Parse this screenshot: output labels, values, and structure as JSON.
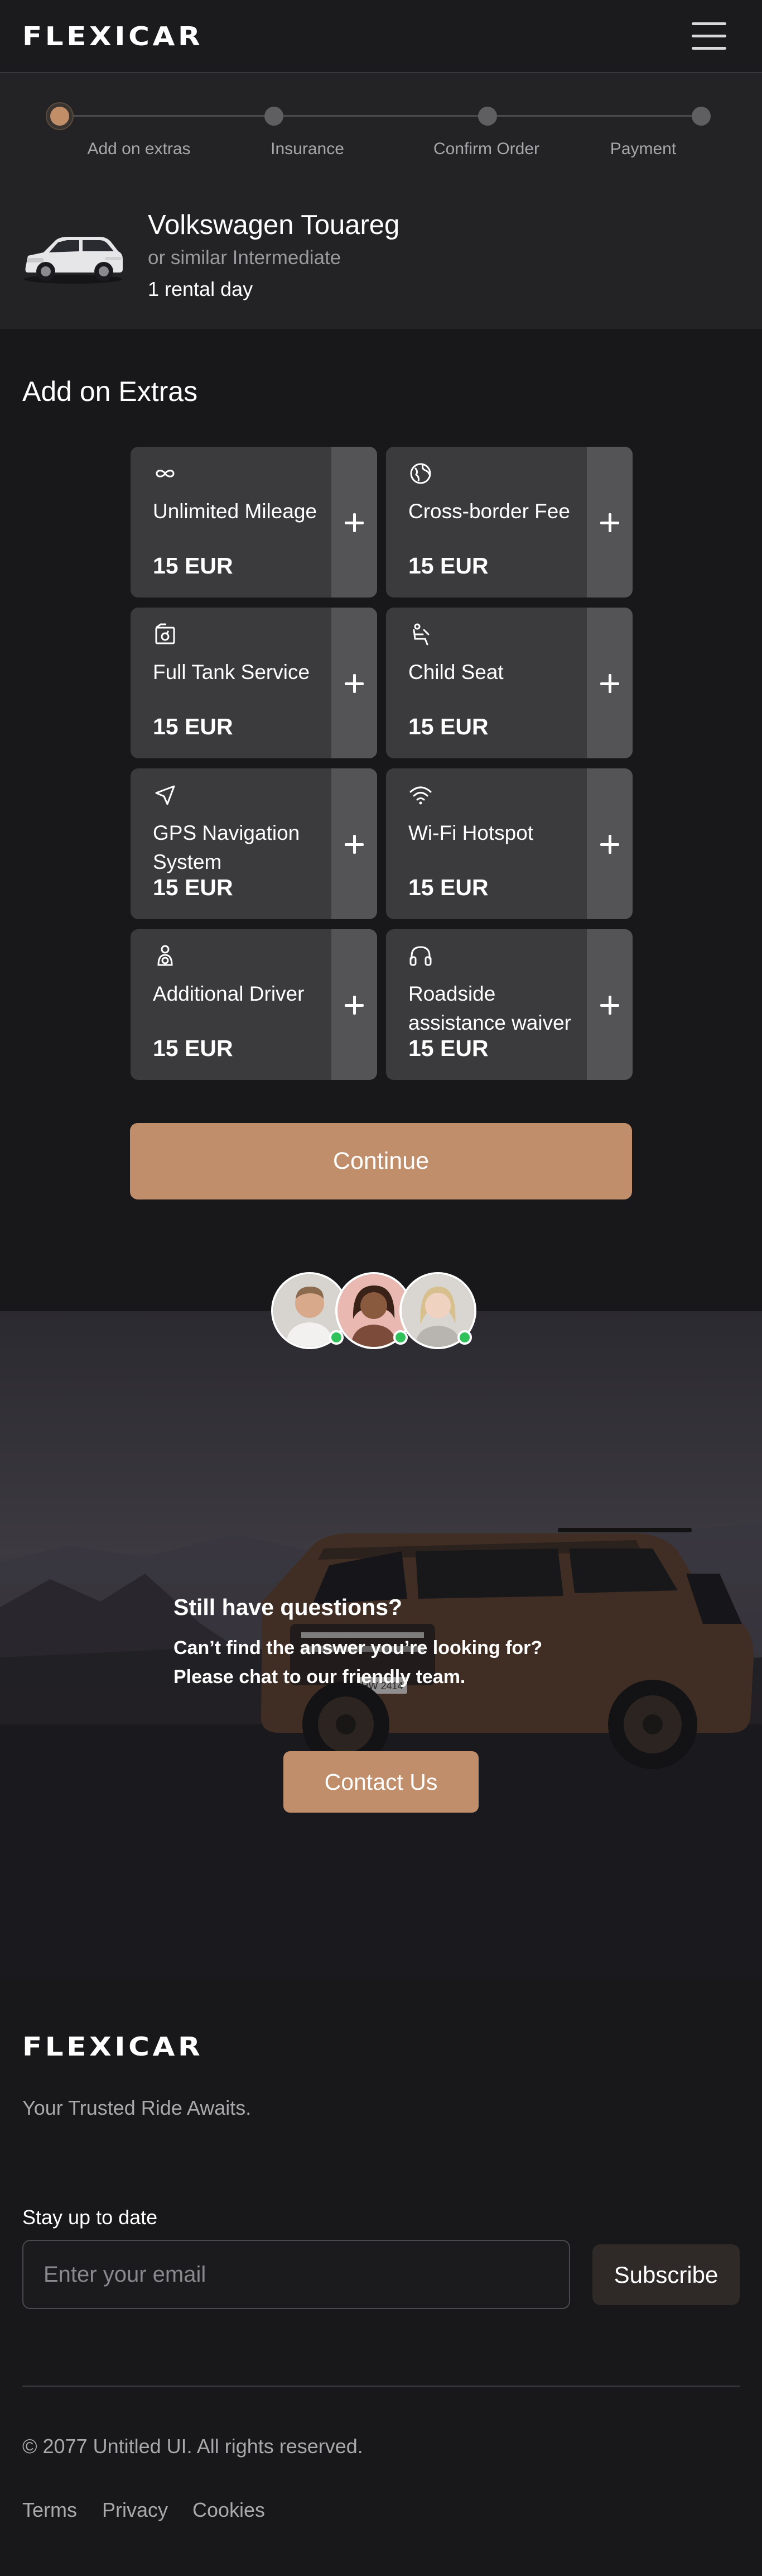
{
  "header": {
    "logo": "FLEXICAR",
    "menu_icon": "hamburger-menu-icon"
  },
  "stepper": {
    "current_step": 1,
    "steps": [
      {
        "label": "Add on extras"
      },
      {
        "label": "Insurance"
      },
      {
        "label": "Confirm Order"
      },
      {
        "label": "Payment"
      }
    ]
  },
  "booking": {
    "car_name": "Volkswagen Touareg",
    "car_class": "or similar Intermediate",
    "rental_days": "1 rental day"
  },
  "extras": {
    "title": "Add on Extras",
    "items": [
      {
        "icon": "infinity-icon",
        "name": "Unlimited Mileage",
        "price": "15 EUR"
      },
      {
        "icon": "globe-icon",
        "name": "Cross-border Fee",
        "price": "15 EUR"
      },
      {
        "icon": "fuel-pump-icon",
        "name": "Full Tank Service",
        "price": "15 EUR"
      },
      {
        "icon": "child-seat-icon",
        "name": "Child Seat",
        "price": "15 EUR"
      },
      {
        "icon": "navigation-arrow-icon",
        "name": "GPS Navigation System",
        "price": "15 EUR"
      },
      {
        "icon": "wifi-icon",
        "name": "Wi-Fi Hotspot",
        "price": "15 EUR"
      },
      {
        "icon": "driver-icon",
        "name": "Additional Driver",
        "price": "15 EUR"
      },
      {
        "icon": "headphones-icon",
        "name": "Roadside assistance waiver",
        "price": "15 EUR"
      }
    ],
    "add_icon": "plus-icon",
    "continue_label": "Continue"
  },
  "contact": {
    "heading": "Still have questions?",
    "subtext": "Can’t find the answer you’re looking for? Please chat to our friendly team.",
    "button_label": "Contact Us",
    "license_plate": "HW 2414"
  },
  "footer": {
    "logo": "FLEXICAR",
    "tagline": "Your Trusted Ride Awaits.",
    "newsletter_label": "Stay up to date",
    "email_placeholder": "Enter your email",
    "subscribe_label": "Subscribe",
    "copyright": "© 2077 Untitled UI. All rights reserved.",
    "links": [
      "Terms",
      "Privacy",
      "Cookies"
    ]
  },
  "colors": {
    "accent": "#c08e6b",
    "background": "#18171a",
    "panel": "#232225",
    "card": "#3b3b3e",
    "card_button": "#545457",
    "online_status": "#2fc25b"
  }
}
